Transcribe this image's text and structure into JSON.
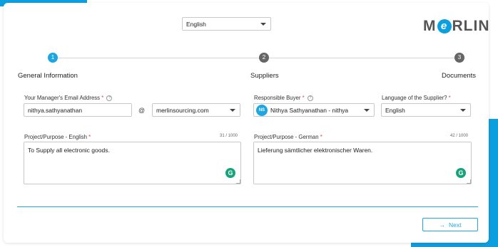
{
  "header": {
    "language_select": "English",
    "logo_text_left": "M",
    "logo_text_e": "e",
    "logo_text_right": "RLIN"
  },
  "steps": [
    {
      "number": "1",
      "label": "General Information"
    },
    {
      "number": "2",
      "label": "Suppliers"
    },
    {
      "number": "3",
      "label": "Documents"
    }
  ],
  "manager_email": {
    "label": "Your Manager's Email Address",
    "required_mark": "*",
    "help_icon": "question-icon",
    "username": "nithya.sathyanathan",
    "at_symbol": "@",
    "domain": "merlinsourcing.com"
  },
  "responsible_buyer": {
    "label": "Responsible Buyer",
    "required_mark": "*",
    "avatar_initials": "NS",
    "value": "Nithya Sathyanathan - nithya"
  },
  "supplier_language": {
    "label": "Language of the Supplier?",
    "required_mark": "*",
    "value": "English"
  },
  "purpose_english": {
    "label": "Project/Purpose - English",
    "required_mark": "*",
    "counter": "31 / 1000",
    "value": "To Supply all electronic goods."
  },
  "purpose_german": {
    "label": "Project/Purpose - German",
    "required_mark": "*",
    "counter": "42 / 1000",
    "value": "Lieferung sämtlicher elektronischer Waren."
  },
  "footer": {
    "next_label": "Next",
    "next_icon": "arrow-right-icon"
  },
  "colors": {
    "accent": "#1ea6e3",
    "required": "#e04848",
    "grammarly": "#15a37a"
  }
}
